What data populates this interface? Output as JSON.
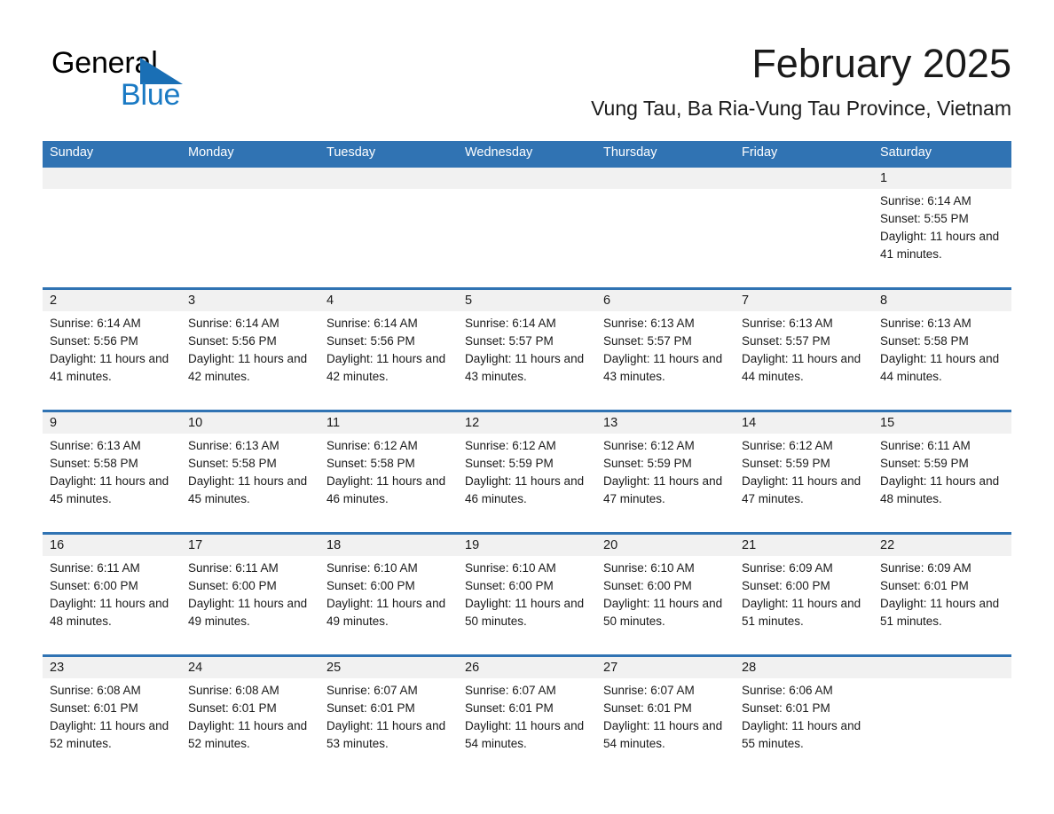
{
  "brand": {
    "word_general": "General",
    "word_blue": "Blue",
    "logo_color": "#1a6fb5"
  },
  "header": {
    "month_title": "February 2025",
    "location": "Vung Tau, Ba Ria-Vung Tau Province, Vietnam"
  },
  "theme": {
    "header_blue": "#3073b3",
    "num_band_gray": "#f1f1f1",
    "text_color": "#1a1a1a"
  },
  "weekdays": [
    "Sunday",
    "Monday",
    "Tuesday",
    "Wednesday",
    "Thursday",
    "Friday",
    "Saturday"
  ],
  "labels": {
    "sunrise_prefix": "Sunrise:",
    "sunset_prefix": "Sunset:",
    "daylight_prefix": "Daylight:"
  },
  "weeks": [
    {
      "days": [
        {
          "date": "",
          "sunrise": "",
          "sunset": "",
          "daylight": ""
        },
        {
          "date": "",
          "sunrise": "",
          "sunset": "",
          "daylight": ""
        },
        {
          "date": "",
          "sunrise": "",
          "sunset": "",
          "daylight": ""
        },
        {
          "date": "",
          "sunrise": "",
          "sunset": "",
          "daylight": ""
        },
        {
          "date": "",
          "sunrise": "",
          "sunset": "",
          "daylight": ""
        },
        {
          "date": "",
          "sunrise": "",
          "sunset": "",
          "daylight": ""
        },
        {
          "date": "1",
          "sunrise": "Sunrise: 6:14 AM",
          "sunset": "Sunset: 5:55 PM",
          "daylight": "Daylight: 11 hours and 41 minutes."
        }
      ]
    },
    {
      "days": [
        {
          "date": "2",
          "sunrise": "Sunrise: 6:14 AM",
          "sunset": "Sunset: 5:56 PM",
          "daylight": "Daylight: 11 hours and 41 minutes."
        },
        {
          "date": "3",
          "sunrise": "Sunrise: 6:14 AM",
          "sunset": "Sunset: 5:56 PM",
          "daylight": "Daylight: 11 hours and 42 minutes."
        },
        {
          "date": "4",
          "sunrise": "Sunrise: 6:14 AM",
          "sunset": "Sunset: 5:56 PM",
          "daylight": "Daylight: 11 hours and 42 minutes."
        },
        {
          "date": "5",
          "sunrise": "Sunrise: 6:14 AM",
          "sunset": "Sunset: 5:57 PM",
          "daylight": "Daylight: 11 hours and 43 minutes."
        },
        {
          "date": "6",
          "sunrise": "Sunrise: 6:13 AM",
          "sunset": "Sunset: 5:57 PM",
          "daylight": "Daylight: 11 hours and 43 minutes."
        },
        {
          "date": "7",
          "sunrise": "Sunrise: 6:13 AM",
          "sunset": "Sunset: 5:57 PM",
          "daylight": "Daylight: 11 hours and 44 minutes."
        },
        {
          "date": "8",
          "sunrise": "Sunrise: 6:13 AM",
          "sunset": "Sunset: 5:58 PM",
          "daylight": "Daylight: 11 hours and 44 minutes."
        }
      ]
    },
    {
      "days": [
        {
          "date": "9",
          "sunrise": "Sunrise: 6:13 AM",
          "sunset": "Sunset: 5:58 PM",
          "daylight": "Daylight: 11 hours and 45 minutes."
        },
        {
          "date": "10",
          "sunrise": "Sunrise: 6:13 AM",
          "sunset": "Sunset: 5:58 PM",
          "daylight": "Daylight: 11 hours and 45 minutes."
        },
        {
          "date": "11",
          "sunrise": "Sunrise: 6:12 AM",
          "sunset": "Sunset: 5:58 PM",
          "daylight": "Daylight: 11 hours and 46 minutes."
        },
        {
          "date": "12",
          "sunrise": "Sunrise: 6:12 AM",
          "sunset": "Sunset: 5:59 PM",
          "daylight": "Daylight: 11 hours and 46 minutes."
        },
        {
          "date": "13",
          "sunrise": "Sunrise: 6:12 AM",
          "sunset": "Sunset: 5:59 PM",
          "daylight": "Daylight: 11 hours and 47 minutes."
        },
        {
          "date": "14",
          "sunrise": "Sunrise: 6:12 AM",
          "sunset": "Sunset: 5:59 PM",
          "daylight": "Daylight: 11 hours and 47 minutes."
        },
        {
          "date": "15",
          "sunrise": "Sunrise: 6:11 AM",
          "sunset": "Sunset: 5:59 PM",
          "daylight": "Daylight: 11 hours and 48 minutes."
        }
      ]
    },
    {
      "days": [
        {
          "date": "16",
          "sunrise": "Sunrise: 6:11 AM",
          "sunset": "Sunset: 6:00 PM",
          "daylight": "Daylight: 11 hours and 48 minutes."
        },
        {
          "date": "17",
          "sunrise": "Sunrise: 6:11 AM",
          "sunset": "Sunset: 6:00 PM",
          "daylight": "Daylight: 11 hours and 49 minutes."
        },
        {
          "date": "18",
          "sunrise": "Sunrise: 6:10 AM",
          "sunset": "Sunset: 6:00 PM",
          "daylight": "Daylight: 11 hours and 49 minutes."
        },
        {
          "date": "19",
          "sunrise": "Sunrise: 6:10 AM",
          "sunset": "Sunset: 6:00 PM",
          "daylight": "Daylight: 11 hours and 50 minutes."
        },
        {
          "date": "20",
          "sunrise": "Sunrise: 6:10 AM",
          "sunset": "Sunset: 6:00 PM",
          "daylight": "Daylight: 11 hours and 50 minutes."
        },
        {
          "date": "21",
          "sunrise": "Sunrise: 6:09 AM",
          "sunset": "Sunset: 6:00 PM",
          "daylight": "Daylight: 11 hours and 51 minutes."
        },
        {
          "date": "22",
          "sunrise": "Sunrise: 6:09 AM",
          "sunset": "Sunset: 6:01 PM",
          "daylight": "Daylight: 11 hours and 51 minutes."
        }
      ]
    },
    {
      "days": [
        {
          "date": "23",
          "sunrise": "Sunrise: 6:08 AM",
          "sunset": "Sunset: 6:01 PM",
          "daylight": "Daylight: 11 hours and 52 minutes."
        },
        {
          "date": "24",
          "sunrise": "Sunrise: 6:08 AM",
          "sunset": "Sunset: 6:01 PM",
          "daylight": "Daylight: 11 hours and 52 minutes."
        },
        {
          "date": "25",
          "sunrise": "Sunrise: 6:07 AM",
          "sunset": "Sunset: 6:01 PM",
          "daylight": "Daylight: 11 hours and 53 minutes."
        },
        {
          "date": "26",
          "sunrise": "Sunrise: 6:07 AM",
          "sunset": "Sunset: 6:01 PM",
          "daylight": "Daylight: 11 hours and 54 minutes."
        },
        {
          "date": "27",
          "sunrise": "Sunrise: 6:07 AM",
          "sunset": "Sunset: 6:01 PM",
          "daylight": "Daylight: 11 hours and 54 minutes."
        },
        {
          "date": "28",
          "sunrise": "Sunrise: 6:06 AM",
          "sunset": "Sunset: 6:01 PM",
          "daylight": "Daylight: 11 hours and 55 minutes."
        },
        {
          "date": "",
          "sunrise": "",
          "sunset": "",
          "daylight": ""
        }
      ]
    }
  ]
}
